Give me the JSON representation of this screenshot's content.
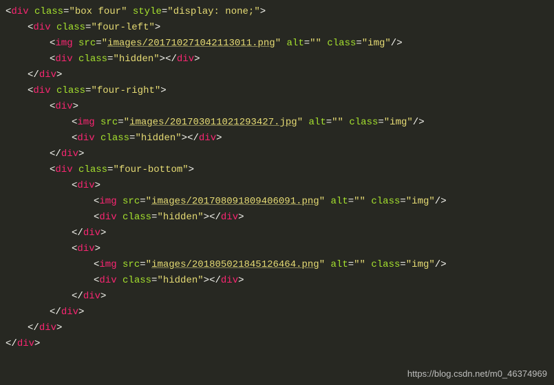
{
  "code": {
    "l1": {
      "tag": "div",
      "cls": "class",
      "clsv": "\"box four\"",
      "sty": "style",
      "styv": "\"display: none;\""
    },
    "l2": {
      "tag": "div",
      "cls": "class",
      "clsv": "\"four-left\""
    },
    "l3": {
      "tag": "img",
      "src": "src",
      "srcv": "\"",
      "srcpath": "images/201710271042113011.png",
      "srcend": "\"",
      "alt": "alt",
      "altv": "\"\"",
      "cls": "class",
      "clsv": "\"img\""
    },
    "l4": {
      "tag": "div",
      "cls": "class",
      "clsv": "\"hidden\"",
      "closetag": "div"
    },
    "l5": {
      "closetag": "div"
    },
    "l6": {
      "tag": "div",
      "cls": "class",
      "clsv": "\"four-right\""
    },
    "l7": {
      "tag": "div"
    },
    "l8": {
      "tag": "img",
      "src": "src",
      "srcv": "\"",
      "srcpath": "images/201703011021293427.jpg",
      "srcend": "\"",
      "alt": "alt",
      "altv": "\"\"",
      "cls": "class",
      "clsv": "\"img\""
    },
    "l9": {
      "tag": "div",
      "cls": "class",
      "clsv": "\"hidden\"",
      "closetag": "div"
    },
    "l10": {
      "closetag": "div"
    },
    "l11": {
      "tag": "div",
      "cls": "class",
      "clsv": "\"four-bottom\""
    },
    "l12": {
      "tag": "div"
    },
    "l13": {
      "tag": "img",
      "src": "src",
      "srcv": "\"",
      "srcpath": "images/201708091809406091.png",
      "srcend": "\"",
      "alt": "alt",
      "altv": "\"\"",
      "cls": "class",
      "clsv": "\"img\""
    },
    "l14": {
      "tag": "div",
      "cls": "class",
      "clsv": "\"hidden\"",
      "closetag": "div"
    },
    "l15": {
      "closetag": "div"
    },
    "l16": {
      "tag": "div"
    },
    "l17": {
      "tag": "img",
      "src": "src",
      "srcv": "\"",
      "srcpath": "images/201805021845126464.png",
      "srcend": "\"",
      "alt": "alt",
      "altv": "\"\"",
      "cls": "class",
      "clsv": "\"img\""
    },
    "l18": {
      "tag": "div",
      "cls": "class",
      "clsv": "\"hidden\"",
      "closetag": "div"
    },
    "l19": {
      "closetag": "div"
    },
    "l20": {
      "closetag": "div"
    },
    "l21": {
      "closetag": "div"
    },
    "l22": {
      "closetag": "div"
    }
  },
  "watermark": "https://blog.csdn.net/m0_46374969"
}
